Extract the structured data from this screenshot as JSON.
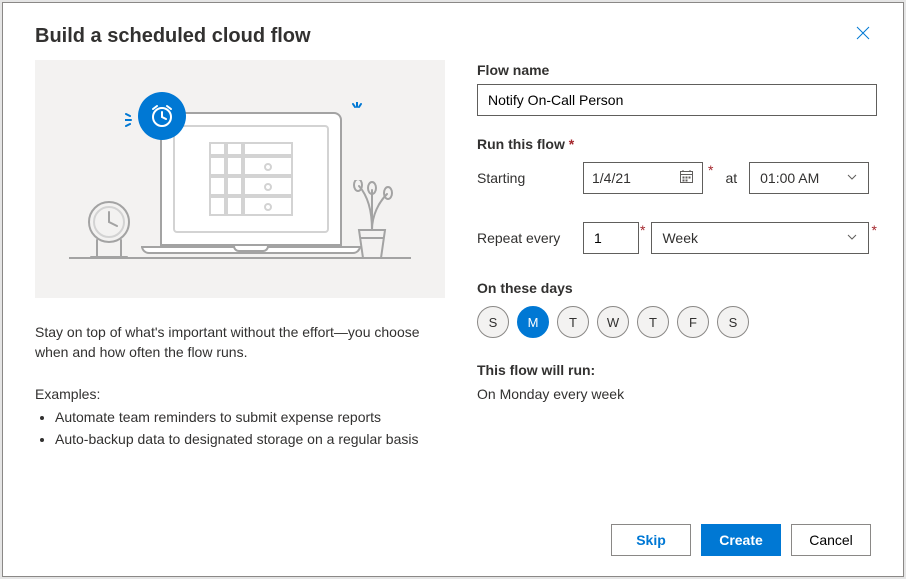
{
  "dialog": {
    "title": "Build a scheduled cloud flow"
  },
  "left": {
    "description": "Stay on top of what's important without the effort—you choose when and how often the flow runs.",
    "examples_label": "Examples:",
    "examples": [
      "Automate team reminders to submit expense reports",
      "Auto-backup data to designated storage on a regular basis"
    ]
  },
  "form": {
    "flow_name_label": "Flow name",
    "flow_name_value": "Notify On-Call Person",
    "run_label": "Run this flow",
    "starting_label": "Starting",
    "starting_value": "1/4/21",
    "at_label": "at",
    "time_value": "01:00 AM",
    "repeat_label": "Repeat every",
    "repeat_count": "1",
    "repeat_unit": "Week",
    "days_label": "On these days",
    "days": [
      {
        "letter": "S",
        "selected": false
      },
      {
        "letter": "M",
        "selected": true
      },
      {
        "letter": "T",
        "selected": false
      },
      {
        "letter": "W",
        "selected": false
      },
      {
        "letter": "T",
        "selected": false
      },
      {
        "letter": "F",
        "selected": false
      },
      {
        "letter": "S",
        "selected": false
      }
    ],
    "summary_label": "This flow will run:",
    "summary_value": "On Monday every week"
  },
  "footer": {
    "skip": "Skip",
    "create": "Create",
    "cancel": "Cancel"
  }
}
